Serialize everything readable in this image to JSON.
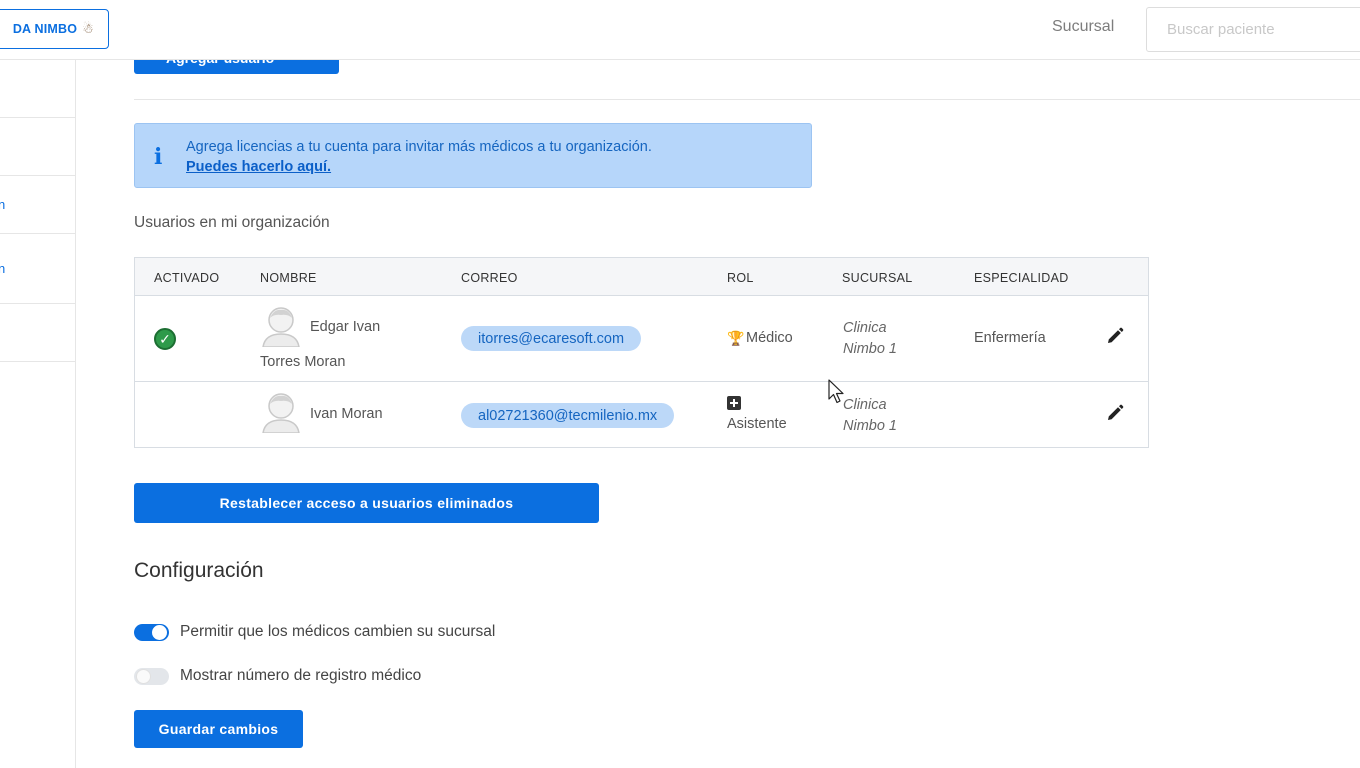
{
  "header": {
    "brand": "DA NIMBO",
    "brand_icon": "brand-emblem-icon",
    "sucursal_label": "Sucursal",
    "search_placeholder": "Buscar paciente"
  },
  "sidebar": {
    "items": [
      {
        "label": ""
      },
      {
        "label": ""
      },
      {
        "label": "n"
      },
      {
        "label": "n"
      },
      {
        "label": ""
      }
    ]
  },
  "main": {
    "add_user_button": "Agregar usuario",
    "info": {
      "message": "Agrega licencias a tu cuenta para invitar más médicos a tu organización.",
      "link": "Puedes hacerlo aquí.",
      "icon": "info-icon"
    },
    "users_title": "Usuarios en mi organización",
    "table": {
      "headers": [
        "ACTIVADO",
        "NOMBRE",
        "CORREO",
        "ROL",
        "SUCURSAL",
        "ESPECIALIDAD"
      ],
      "rows": [
        {
          "activated": true,
          "name_line1": "Edgar Ivan",
          "name_line2": "Torres Moran",
          "email": "itorres@ecaresoft.com",
          "role": "Médico",
          "role_icon": "trophy-icon",
          "branch_line1": "Clinica",
          "branch_line2": "Nimbo 1",
          "specialty": "Enfermería"
        },
        {
          "activated": false,
          "name_line1": "Ivan Moran",
          "name_line2": "",
          "email": "al02721360@tecmilenio.mx",
          "role": "Asistente",
          "role_icon": "plus-square-icon",
          "branch_line1": "Clinica",
          "branch_line2": "Nimbo 1",
          "specialty": ""
        }
      ]
    },
    "restore_button": "Restablecer acceso a usuarios eliminados",
    "config": {
      "title": "Configuración",
      "toggles": [
        {
          "label": "Permitir que los médicos cambien su sucursal",
          "on": true
        },
        {
          "label": "Mostrar número de registro médico",
          "on": false
        }
      ],
      "save_button": "Guardar cambios"
    }
  },
  "colors": {
    "accent": "#0b6fe0",
    "info_bg": "#b6d6fa",
    "success": "#2e9a4a"
  }
}
